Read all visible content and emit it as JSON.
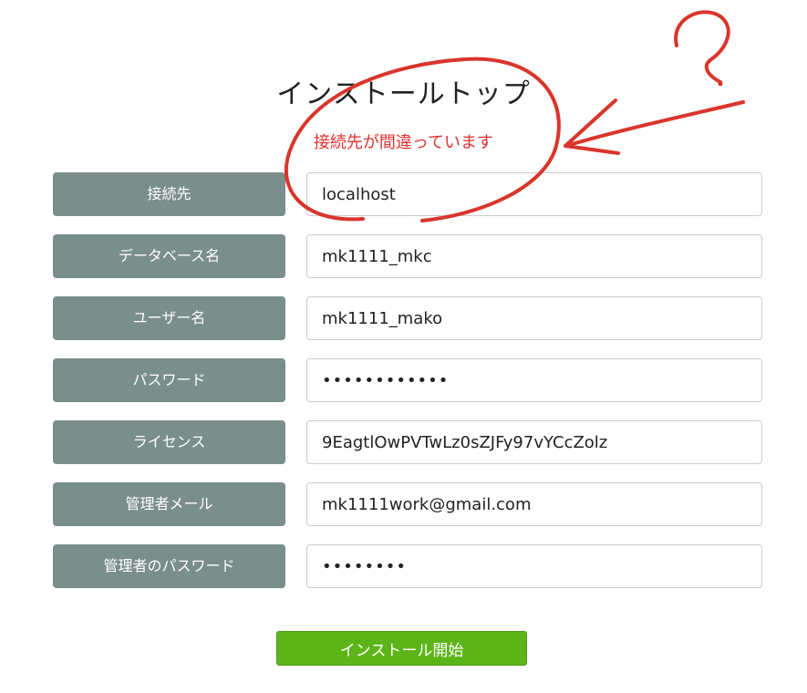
{
  "page": {
    "title": "インストールトップ",
    "error_message": "接続先が間違っています"
  },
  "form": {
    "fields": [
      {
        "label": "接続先",
        "value": "localhost",
        "type": "text"
      },
      {
        "label": "データベース名",
        "value": "mk1111_mkc",
        "type": "text"
      },
      {
        "label": "ユーザー名",
        "value": "mk1111_mako",
        "type": "text"
      },
      {
        "label": "パスワード",
        "value": "••••••••••••",
        "type": "password"
      },
      {
        "label": "ライセンス",
        "value": "9EagtlOwPVTwLz0sZJFy97vYCcZolz",
        "type": "text"
      },
      {
        "label": "管理者メール",
        "value": "mk1111work@gmail.com",
        "type": "text"
      },
      {
        "label": "管理者のパスワード",
        "value": "••••••••",
        "type": "password"
      }
    ]
  },
  "actions": {
    "install_label": "インストール開始"
  },
  "annotation": {
    "mark": "?",
    "color": "#d9352c"
  },
  "colors": {
    "label_bg": "#7a8e8c",
    "button_bg": "#5cb518",
    "error_text": "#e0312f"
  }
}
